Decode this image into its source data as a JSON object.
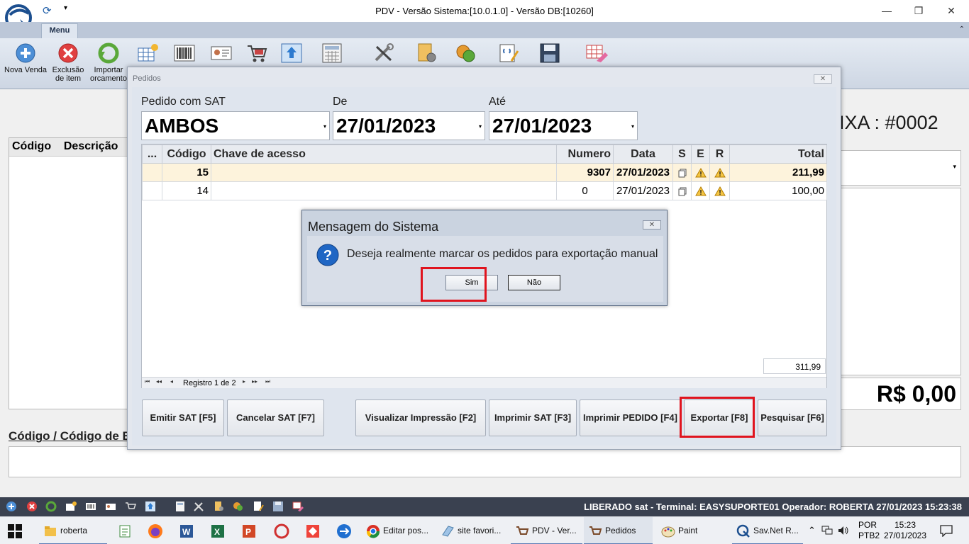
{
  "window": {
    "title": "PDV - Versão Sistema:[10.0.1.0] - Versão DB:[10260]",
    "minimize_glyph": "—",
    "maximize_glyph": "❐",
    "close_glyph": "✕",
    "dropdown_glyph": "▾"
  },
  "ribbon": {
    "tab": "Menu",
    "collapse_glyph": "⌃",
    "buttons": {
      "nova_venda": "Nova Venda",
      "exclusao_l1": "Exclusão",
      "exclusao_l2": "de item",
      "importar_l1": "Importar",
      "importar_l2": "orcamento"
    }
  },
  "main": {
    "caixa": "IXA : #0002",
    "grid_codigo": "Código",
    "grid_descricao": "Descrição",
    "combo_arrow": "▾",
    "total": "R$ 0,00",
    "codigo_label": "Código / Código de B"
  },
  "pedidos": {
    "title": "Pedidos",
    "close_glyph": "✕",
    "filters": {
      "sat_label": "Pedido com SAT",
      "sat_value": "AMBOS",
      "de_label": "De",
      "de_value": "27/01/2023",
      "ate_label": "Até",
      "ate_value": "27/01/2023",
      "arrow": "▾"
    },
    "columns": {
      "sel": "...",
      "codigo": "Código",
      "chave": "Chave de acesso",
      "numero": "Numero",
      "data": "Data",
      "s": "S",
      "e": "E",
      "r": "R",
      "total": "Total"
    },
    "rows": [
      {
        "codigo": "15",
        "chave": "",
        "numero": "9307",
        "data": "27/01/2023",
        "total": "211,99"
      },
      {
        "codigo": "14",
        "chave": "",
        "numero": "0",
        "data": "27/01/2023",
        "total": "100,00"
      }
    ],
    "sum": "311,99",
    "nav": {
      "first": "⏮",
      "prev_page": "◂◂",
      "prev": "◂",
      "record": "Registro 1 de 2",
      "next": "▸",
      "next_page": "▸▸",
      "last": "⏭"
    },
    "buttons": {
      "emitir": "Emitir SAT [F5]",
      "cancelar": "Cancelar SAT [F7]",
      "visualizar": "Visualizar Impressão [F2]",
      "imprimir_sat": "Imprimir SAT [F3]",
      "imprimir_pedido": "Imprimir PEDIDO [F4]",
      "exportar": "Exportar [F8]",
      "pesquisar": "Pesquisar [F6]"
    }
  },
  "message": {
    "title": "Mensagem do Sistema",
    "close_glyph": "✕",
    "text": "Deseja realmente marcar os pedidos para exportação manual",
    "icon_glyph": "?",
    "yes": "Sim",
    "no": "Não"
  },
  "status": {
    "text": "LIBERADO   sat   -   Terminal: EASYSUPORTE01   Operador: ROBERTA    27/01/2023 15:23:38"
  },
  "taskbar": {
    "items": [
      "roberta",
      "Editar pos...",
      "site favori...",
      "PDV - Ver...",
      "Pedidos",
      "Paint",
      "Sav.Net R..."
    ],
    "lang_l1": "POR",
    "lang_l2": "PTB2",
    "time": "15:23",
    "date": "27/01/2023",
    "tray_up": "⌃"
  },
  "colors": {
    "highlight": "#e0141e",
    "status_bar": "#3a4150",
    "selected_row": "#fdf3dc"
  }
}
